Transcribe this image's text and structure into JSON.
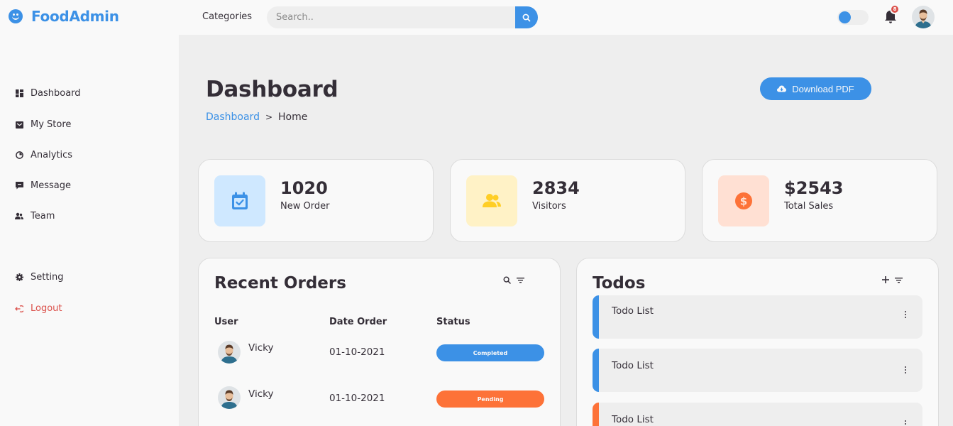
{
  "app": {
    "name": "FoodAdmin"
  },
  "topbar": {
    "nav_link": "Categories",
    "search_placeholder": "Search..",
    "notification_count": "8"
  },
  "sidebar": {
    "items": [
      {
        "label": "Dashboard",
        "icon": "dashboard-icon"
      },
      {
        "label": "My Store",
        "icon": "store-icon"
      },
      {
        "label": "Analytics",
        "icon": "analytics-icon"
      },
      {
        "label": "Message",
        "icon": "message-icon"
      },
      {
        "label": "Team",
        "icon": "team-icon"
      }
    ],
    "bottom": [
      {
        "label": "Setting",
        "icon": "gear-icon"
      },
      {
        "label": "Logout",
        "icon": "logout-icon"
      }
    ]
  },
  "main": {
    "title": "Dashboard",
    "breadcrumb": {
      "link": "Dashboard",
      "separator": ">",
      "current": "Home"
    },
    "download_label": "Download PDF"
  },
  "stats": [
    {
      "value": "1020",
      "label": "New Order",
      "icon": "calendar-check-icon",
      "color": "#3c91e6",
      "bg": "#cfe8ff"
    },
    {
      "value": "2834",
      "label": "Visitors",
      "icon": "people-icon",
      "color": "#ffce26",
      "bg": "#fff2c6"
    },
    {
      "value": "$2543",
      "label": "Total Sales",
      "icon": "dollar-circle-icon",
      "color": "#fd7238",
      "bg": "#ffe0d3"
    }
  ],
  "orders": {
    "title": "Recent Orders",
    "columns": [
      "User",
      "Date Order",
      "Status"
    ],
    "rows": [
      {
        "user": "Vicky",
        "date": "01-10-2021",
        "status": "Completed",
        "status_color": "#3c91e6"
      },
      {
        "user": "Vicky",
        "date": "01-10-2021",
        "status": "Pending",
        "status_color": "#fd7238"
      }
    ]
  },
  "todos": {
    "title": "Todos",
    "items": [
      {
        "text": "Todo List",
        "color": "#3c91e6"
      },
      {
        "text": "Todo List",
        "color": "#3c91e6"
      },
      {
        "text": "Todo List",
        "color": "#fd7238"
      }
    ]
  }
}
